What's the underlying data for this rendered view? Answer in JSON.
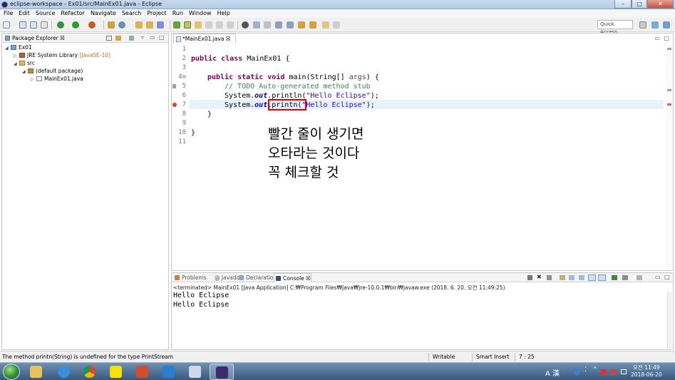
{
  "window": {
    "title": "eclipse-workspace - Ex01/src/MainEx01.java - Eclipse",
    "minimize": "–",
    "maximize": "□",
    "close": "✕"
  },
  "menu": [
    "File",
    "Edit",
    "Source",
    "Refactor",
    "Navigate",
    "Search",
    "Project",
    "Run",
    "Window",
    "Help"
  ],
  "toolbar": {
    "quick_access_placeholder": "Quick Access"
  },
  "package_explorer": {
    "tab_label": "Package Explorer ☒",
    "tree": [
      {
        "label": "Ex01",
        "decoration": "",
        "icon": "java-project-icon"
      },
      {
        "label": "JRE System Library",
        "decoration": "[JavaSE-10]",
        "icon": "library-icon"
      },
      {
        "label": "src",
        "decoration": "",
        "icon": "source-folder-icon"
      },
      {
        "label": "(default package)",
        "decoration": "",
        "icon": "package-icon"
      },
      {
        "label": "MainEx01.java",
        "decoration": "",
        "icon": "java-file-icon"
      }
    ]
  },
  "editor": {
    "tab_label": "*MainEx01.java ☒",
    "line_numbers": [
      "1",
      "2",
      "3",
      "4⊖",
      "5",
      "6",
      "7",
      "8",
      "9",
      "10",
      "11"
    ],
    "lines": {
      "l2_kw": "public class",
      "l2_rest": " MainEx01 {",
      "l4_kw": "public static void",
      "l4_rest": " main(String[] ",
      "l4_param": "args",
      "l4_end": ") {",
      "l5_comment": "// TODO Auto-generated method stub",
      "l6_pre": "System.",
      "l6_field": "out",
      "l6_call": ".println(",
      "l6_str": "\"Hello Eclipse\"",
      "l6_end": ");",
      "l7_pre": "System.",
      "l7_field": "out",
      "l7_call": ".printn(",
      "l7_str": "\"Hello Eclipse\"",
      "l7_end": ");",
      "l8": "}",
      "l10": "}"
    },
    "annotation": [
      "빨간 줄이 생기면",
      "오타라는 것이다",
      "꼭 체크할 것"
    ]
  },
  "console": {
    "tabs": [
      "Problems",
      "@ Javadoc",
      "Declaration",
      "Console ☒"
    ],
    "description": "<terminated> MainEx01 [Java Application] C:₩Program Files₩Java₩jre-10.0.1₩bin₩javaw.exe (2018. 6. 20. 오전 11:49:25)",
    "output": [
      "Hello Eclipse",
      "Hello Eclipse"
    ]
  },
  "status": {
    "message": "The method printn(String) is undefined for the type PrintStream",
    "writable": "Writable",
    "insert_mode": "Smart Insert",
    "position": "7 : 25"
  },
  "taskbar": {
    "time": "오전 11:49",
    "date": "2018-06-20",
    "tray_lang": "A 漢",
    "apps": [
      "explorer-icon",
      "ie-icon",
      "chrome-icon",
      "kakaotalk-icon",
      "powerpoint-icon",
      "vscode-icon",
      "paint-icon",
      "eclipse-icon"
    ]
  },
  "colors": {
    "keyword": "#7f0055",
    "comment": "#3f7f5f",
    "string": "#2a00ff",
    "field": "#0000c0",
    "error_box": "#e00000",
    "current_line": "#e8f2fe"
  }
}
